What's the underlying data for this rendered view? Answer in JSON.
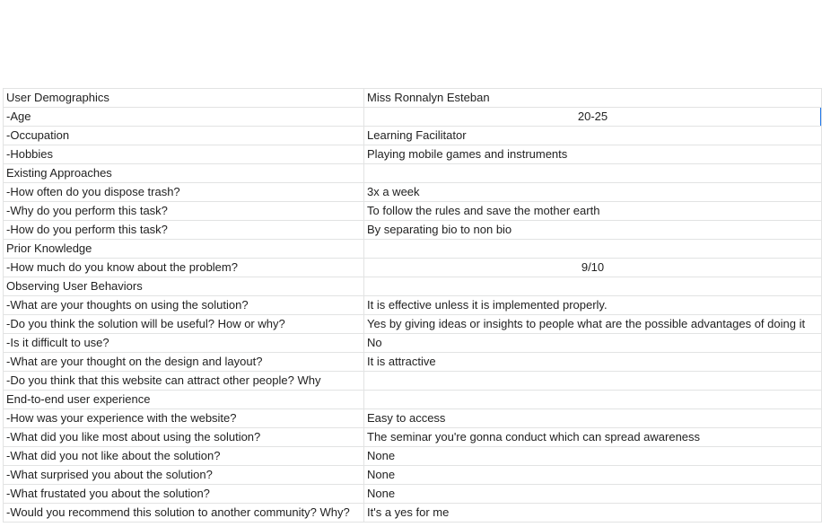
{
  "sheet": {
    "rows": [
      {
        "question": "User Demographics",
        "answer": "Miss Ronnalyn Esteban",
        "align": "left"
      },
      {
        "question": "-Age",
        "answer": "20-25",
        "align": "center",
        "selected": true
      },
      {
        "question": "-Occupation",
        "answer": "Learning Facilitator",
        "align": "left"
      },
      {
        "question": "-Hobbies",
        "answer": "Playing mobile games and instruments",
        "align": "left"
      },
      {
        "question": "Existing Approaches",
        "answer": "",
        "align": "left"
      },
      {
        "question": "-How often do you dispose trash?",
        "answer": "3x a week",
        "align": "left"
      },
      {
        "question": "-Why do you perform this task?",
        "answer": "To follow the rules and save the mother earth",
        "align": "left"
      },
      {
        "question": "-How do you perform this task?",
        "answer": "By separating bio to non bio",
        "align": "left"
      },
      {
        "question": "Prior Knowledge",
        "answer": "",
        "align": "left"
      },
      {
        "question": "-How much do you know about the problem?",
        "answer": "9/10",
        "align": "center"
      },
      {
        "question": "Observing User Behaviors",
        "answer": "",
        "align": "left"
      },
      {
        "question": "-What are your thoughts on using the solution?",
        "answer": "It is effective unless it is implemented properly.",
        "align": "left"
      },
      {
        "question": "-Do you think the solution will be useful? How or why?",
        "answer": "Yes by giving ideas or insights to people what are the possible advantages of doing it",
        "align": "left"
      },
      {
        "question": "-Is it difficult to use?",
        "answer": "No",
        "align": "left"
      },
      {
        "question": "-What are your thought on the design and layout?",
        "answer": "It is attractive",
        "align": "left"
      },
      {
        "question": "-Do you think that this website can attract other people? Why",
        "answer": "",
        "align": "left"
      },
      {
        "question": "End-to-end user experience",
        "answer": "",
        "align": "left"
      },
      {
        "question": "-How was your experience with the website?",
        "answer": "Easy to access",
        "align": "left"
      },
      {
        "question": "-What did you like most about using the solution?",
        "answer": "The seminar you're gonna conduct which can spread awareness",
        "align": "left"
      },
      {
        "question": "-What did you not like about the solution?",
        "answer": "None",
        "align": "left"
      },
      {
        "question": "-What surprised you about the solution?",
        "answer": "None",
        "align": "left"
      },
      {
        "question": "-What frustated you about the solution?",
        "answer": "None",
        "align": "left"
      },
      {
        "question": "-Would you recommend this solution to another community? Why?",
        "answer": "It's a yes for me",
        "align": "left"
      }
    ]
  },
  "colors": {
    "gridline": "#e2e3e3",
    "text": "#222222",
    "selection": "#1a73e8"
  }
}
